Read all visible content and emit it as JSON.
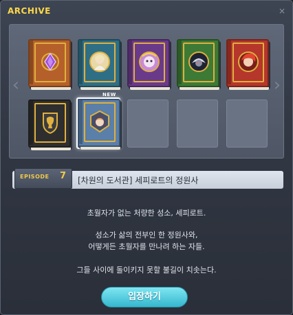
{
  "window": {
    "title": "ARCHIVE",
    "close_symbol": "×"
  },
  "shelf": {
    "nav_left": "‹",
    "nav_right": "›",
    "new_badge": "NEW",
    "books": [
      {
        "color": "#b5602a",
        "emblem": "purple-gem-icon"
      },
      {
        "color": "#2f6f86",
        "emblem": "woman-portrait-icon"
      },
      {
        "color": "#6a3a8a",
        "emblem": "mask-portrait-icon"
      },
      {
        "color": "#3c7a35",
        "emblem": "monster-portrait-icon"
      },
      {
        "color": "#b5362a",
        "emblem": "red-hair-portrait-icon"
      },
      {
        "color": "#2e2e2e",
        "emblem": "lion-crest-icon"
      },
      {
        "color": "#5a7fa8",
        "emblem": "hooded-girl-portrait-icon"
      }
    ],
    "empty_slots": 3
  },
  "episode": {
    "label": "EPISODE",
    "number": "7",
    "title": "[차원의 도서관] 세피로트의 정원사"
  },
  "description": [
    "초월자가 없는 처량한 성소, 세피로트.",
    "성소가 삶의 전부인 한 정원사와,",
    "어떻게든 초월자를 만나려 하는 자들.",
    "그들 사이에 돌이키지 못할 불길이 치솟는다."
  ],
  "enter_button": "입장하기"
}
